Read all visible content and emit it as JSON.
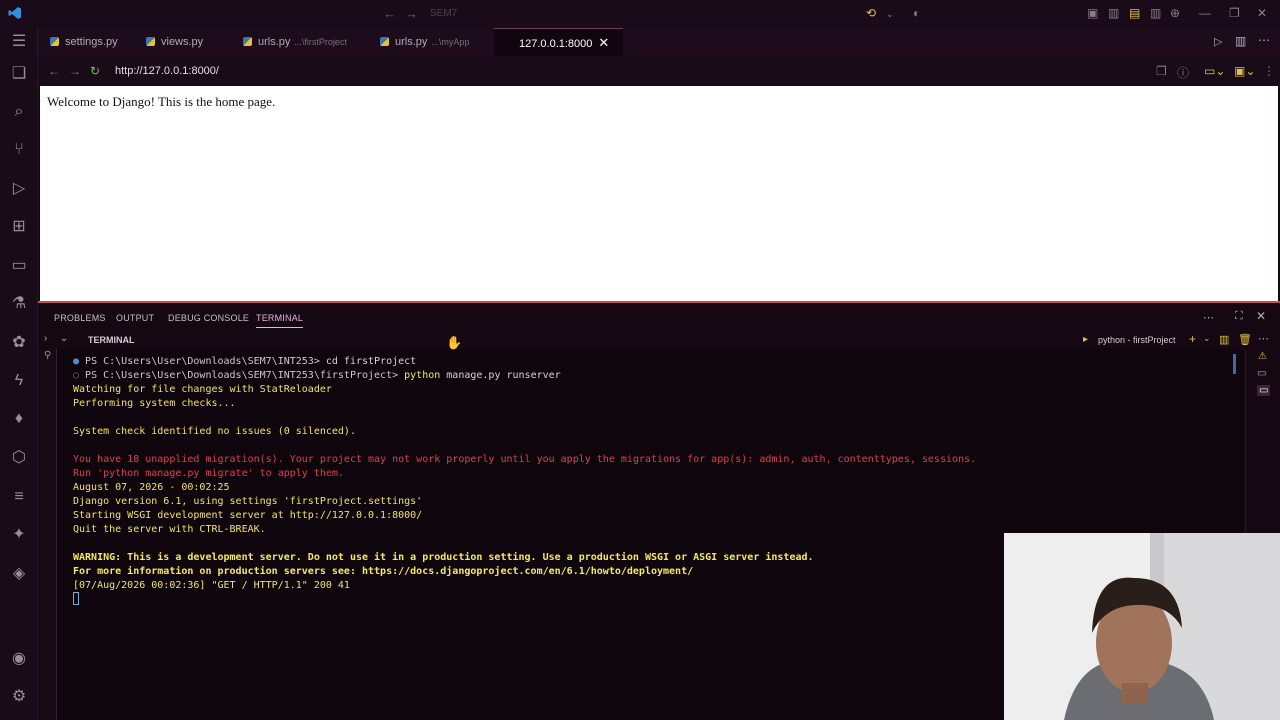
{
  "titlebar": {
    "search_placeholder": "SEM7"
  },
  "tabs": [
    {
      "label": "settings.py",
      "hint": ""
    },
    {
      "label": "views.py",
      "hint": ""
    },
    {
      "label": "urls.py",
      "hint": "...\\firstProject"
    },
    {
      "label": "urls.py",
      "hint": "...\\myApp"
    },
    {
      "label": "127.0.0.1:8000",
      "hint": ""
    }
  ],
  "browser": {
    "url": "http://127.0.0.1:8000/",
    "page_text": "Welcome to Django! This is the home page."
  },
  "panel": {
    "tabs": [
      "PROBLEMS",
      "OUTPUT",
      "DEBUG CONSOLE",
      "TERMINAL"
    ],
    "active_tab": "TERMINAL",
    "section_title": "TERMINAL",
    "profile_label": "python - firstProject"
  },
  "terminal": {
    "l1_prompt": "PS C:\\Users\\User\\Downloads\\SEM7\\INT253> ",
    "l1_cmd": "cd firstProject",
    "l2_prompt": "PS C:\\Users\\User\\Downloads\\SEM7\\INT253\\firstProject> ",
    "l2_cmd_a": "python",
    "l2_cmd_b": " manage.py runserver",
    "l3": "Watching for file changes with StatReloader",
    "l4": "Performing system checks...",
    "l5": "System check identified no issues (0 silenced).",
    "l6": "You have 18 unapplied migration(s). Your project may not work properly until you apply the migrations for app(s): admin, auth, contenttypes, sessions.",
    "l7": "Run 'python manage.py migrate' to apply them.",
    "l8": "August 07, 2026 - 00:02:25",
    "l9": "Django version 6.1, using settings 'firstProject.settings'",
    "l10": "Starting WSGI development server at http://127.0.0.1:8000/",
    "l11": "Quit the server with CTRL-BREAK.",
    "l12": "WARNING: This is a development server. Do not use it in a production setting. Use a production WSGI or ASGI server instead.",
    "l13": "For more information on production servers see: https://docs.djangoproject.com/en/6.1/howto/deployment/",
    "l14": "[07/Aug/2026 00:02:36] \"GET / HTTP/1.1\" 200 41"
  },
  "icons": {
    "activity": [
      "explorer-icon",
      "search-icon",
      "source-control-icon",
      "run-debug-icon",
      "extensions-icon",
      "remote-explorer-icon",
      "testing-icon",
      "extension-puzzle-icon",
      "thunder-icon",
      "mongo-leaf-icon",
      "package-icon",
      "list-icon",
      "copilot-icon",
      "python-icon",
      "account-icon",
      "settings-gear-icon"
    ]
  },
  "colors": {
    "accent": "#c2505a",
    "terminal_yellow": "#f1e36b",
    "terminal_red": "#d9414f"
  }
}
